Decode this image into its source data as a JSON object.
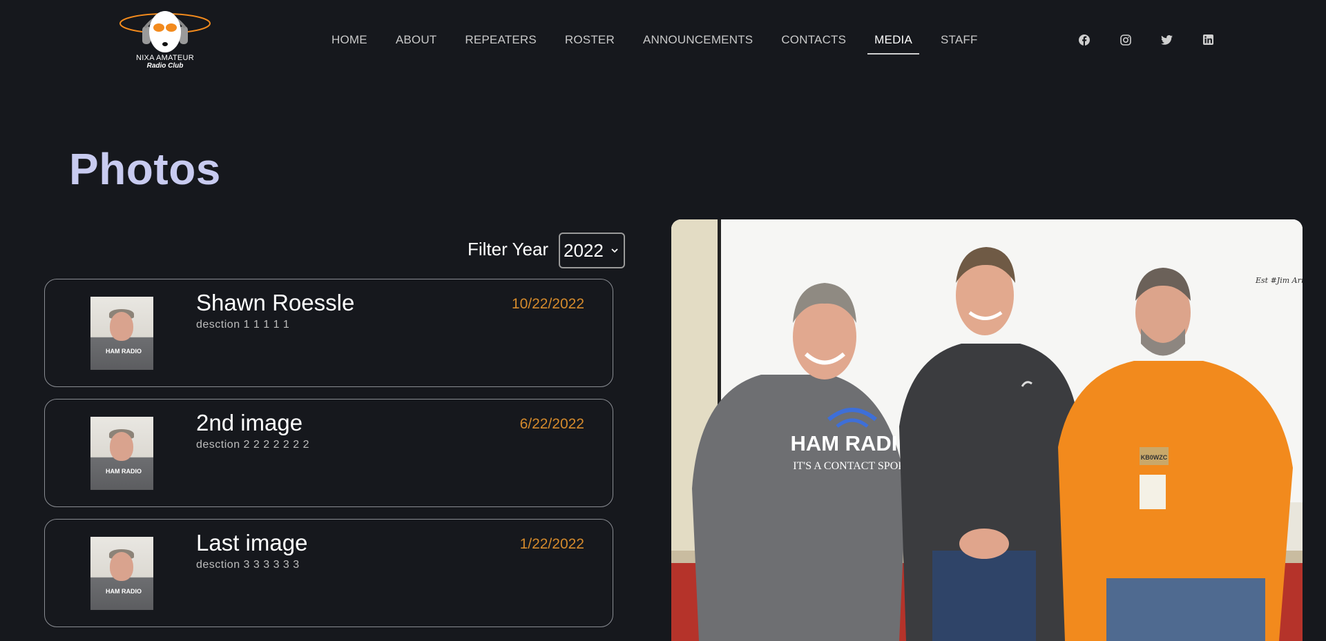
{
  "logo": {
    "line1": "NIXA AMATEUR",
    "line2": "Radio Club"
  },
  "nav": {
    "items": [
      {
        "label": "HOME"
      },
      {
        "label": "ABOUT"
      },
      {
        "label": "REPEATERS"
      },
      {
        "label": "ROSTER"
      },
      {
        "label": "ANNOUNCEMENTS"
      },
      {
        "label": "CONTACTS"
      },
      {
        "label": "MEDIA"
      },
      {
        "label": "STAFF"
      }
    ],
    "active": "MEDIA"
  },
  "social": [
    "facebook-icon",
    "instagram-icon",
    "twitter-icon",
    "linkedin-icon"
  ],
  "page": {
    "title": "Photos"
  },
  "filter": {
    "label": "Filter Year",
    "selected": "2022"
  },
  "photos": [
    {
      "title": "Shawn Roessle",
      "description": "desction 1 1 1 1 1",
      "date": "10/22/2022"
    },
    {
      "title": "2nd image",
      "description": "desction 2 2 2 2 2 2 2",
      "date": "6/22/2022"
    },
    {
      "title": "Last image",
      "description": "desction 3 3 3 3 3 3",
      "date": "1/22/2022"
    }
  ],
  "featured_photo": {
    "shirt_text1": "HAM RADIO",
    "shirt_text2": "IT'S A CONTACT SPORT",
    "badge_text": "KB0WZC",
    "whiteboard_text": "Est #Jim Arm"
  },
  "thumbnail": {
    "shirt_text": "HAM RADIO"
  },
  "colors": {
    "background": "#16181d",
    "title": "#c8cbf0",
    "date": "#d48a2c",
    "accent_orange": "#f28a1d"
  }
}
